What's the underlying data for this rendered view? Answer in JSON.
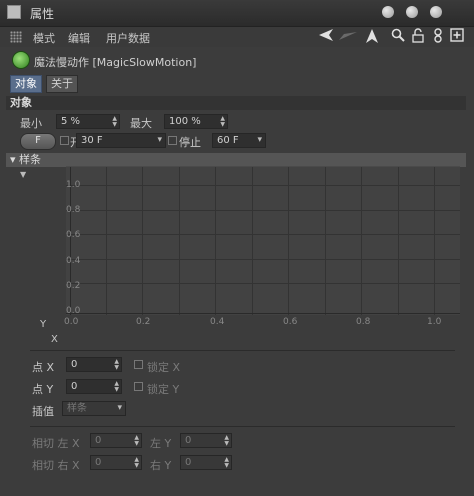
{
  "window": {
    "title": "属性"
  },
  "menu": {
    "items": [
      "模式",
      "编辑",
      "用户数据"
    ]
  },
  "object": {
    "title": "魔法慢动作 [MagicSlowMotion]"
  },
  "tabs": {
    "object": "对象",
    "about": "关于"
  },
  "section": {
    "object": "对象",
    "spline": "样条"
  },
  "params": {
    "min_label": "最小",
    "min_value": "5 %",
    "max_label": "最大",
    "max_value": "100 %",
    "f_button": "F",
    "start_label": "开始",
    "start_value": "30 F",
    "stop_label": "停止",
    "stop_value": "60 F"
  },
  "graph": {
    "y_axis_label": "Y",
    "x_axis_label": "X",
    "y_ticks": [
      "1.0",
      "0.8",
      "0.6",
      "0.4",
      "0.2",
      "0.0"
    ],
    "x_ticks": [
      "0.0",
      "0.2",
      "0.4",
      "0.6",
      "0.8",
      "1.0"
    ]
  },
  "point": {
    "x_label": "点 X",
    "x_value": "0",
    "lock_x": "锁定 X",
    "y_label": "点 Y",
    "y_value": "0",
    "lock_y": "锁定 Y",
    "interp_label": "插值",
    "interp_value": "样条"
  },
  "tangent": {
    "left_x_label": "相切 左 X",
    "left_x_value": "0",
    "left_y_label": "左 Y",
    "left_y_value": "0",
    "right_x_label": "相切 右 X",
    "right_x_value": "0",
    "right_y_label": "右 Y",
    "right_y_value": "0"
  }
}
